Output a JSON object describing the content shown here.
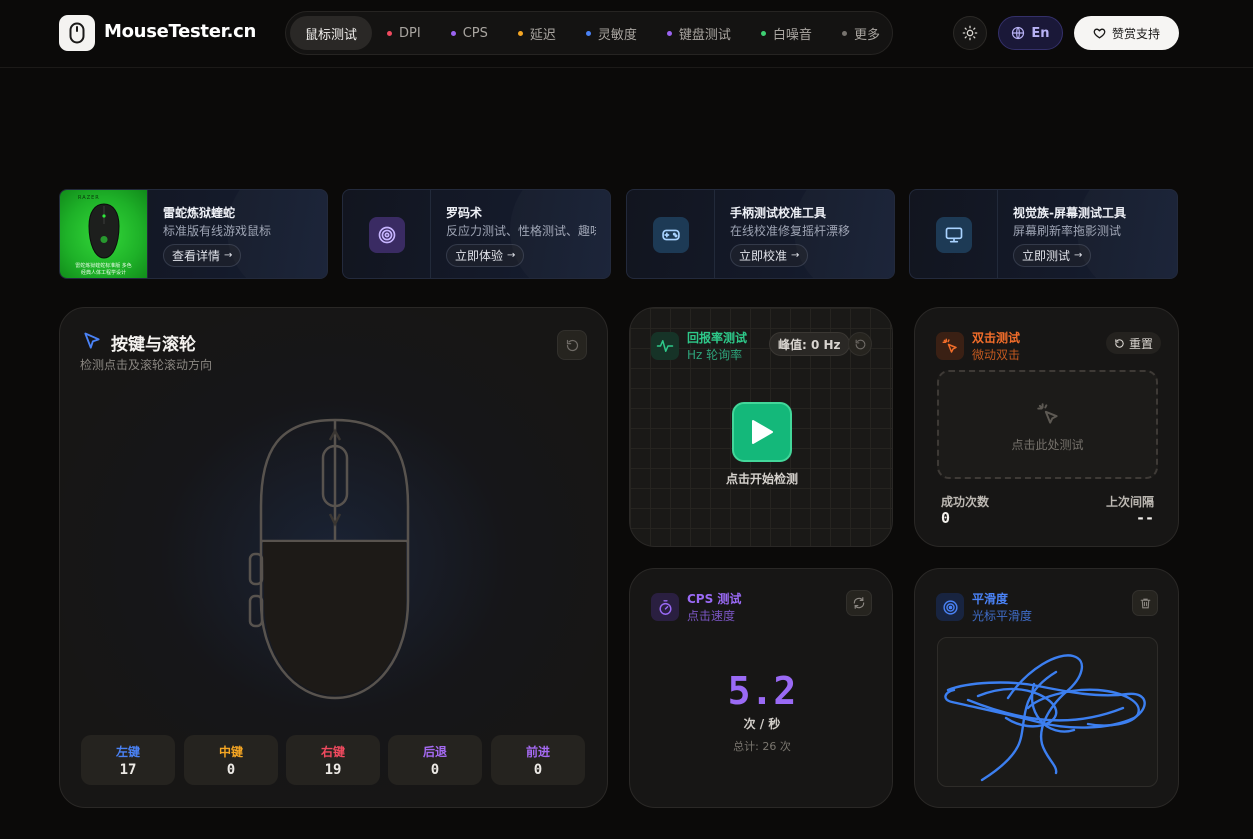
{
  "header": {
    "logo_text": "MouseTester.cn",
    "nav": [
      {
        "label": "鼠标测试",
        "active": true,
        "dot": ""
      },
      {
        "label": "DPI",
        "active": false,
        "dot": "#f04a5f"
      },
      {
        "label": "CPS",
        "active": false,
        "dot": "#9a63f0"
      },
      {
        "label": "延迟",
        "active": false,
        "dot": "#f5a623"
      },
      {
        "label": "灵敏度",
        "active": false,
        "dot": "#4a82f5"
      },
      {
        "label": "键盘测试",
        "active": false,
        "dot": "#9a63f0"
      },
      {
        "label": "白噪音",
        "active": false,
        "dot": "#3ecf72"
      },
      {
        "label": "更多",
        "active": false,
        "dot": "#77736e"
      }
    ],
    "lang_label": "En",
    "donate_label": "赞赏支持"
  },
  "promos": [
    {
      "title": "雷蛇炼狱蝰蛇",
      "desc": "标准版有线游戏鼠标",
      "button": "查看详情",
      "thumb_caption_1": "雷蛇炼狱蝰蛇标准版 多色",
      "thumb_caption_2": "经典人体工程学设计",
      "thumb_brand": "RAZER"
    },
    {
      "title": "罗码术",
      "desc": "反应力测试、性格测试、趣味测试",
      "button": "立即体验"
    },
    {
      "title": "手柄测试校准工具",
      "desc": "在线校准修复摇杆漂移",
      "button": "立即校准"
    },
    {
      "title": "视觉族-屏幕测试工具",
      "desc": "屏幕刷新率拖影测试",
      "button": "立即测试"
    }
  ],
  "buttons_card": {
    "title": "按键与滚轮",
    "subtitle": "检测点击及滚轮滚动方向",
    "stats": [
      {
        "label": "左键",
        "value": "17",
        "color": "#4a82f5"
      },
      {
        "label": "中键",
        "value": "0",
        "color": "#f5a623"
      },
      {
        "label": "右键",
        "value": "19",
        "color": "#f04a5f"
      },
      {
        "label": "后退",
        "value": "0",
        "color": "#a56af2"
      },
      {
        "label": "前进",
        "value": "0",
        "color": "#a56af2"
      }
    ]
  },
  "polling_card": {
    "title": "回报率测试",
    "subtitle": "Hz 轮询率",
    "peak_label": "峰值: 0 Hz",
    "start_label": "点击开始检测",
    "accent": "#2ec98a"
  },
  "double_click_card": {
    "title": "双击测试",
    "subtitle": "微动双击",
    "reset_label": "重置",
    "area_label": "点击此处测试",
    "success_label": "成功次数",
    "success_value": "0",
    "interval_label": "上次间隔",
    "interval_value": "--",
    "accent": "#f26d2a"
  },
  "cps_card": {
    "title": "CPS 测试",
    "subtitle": "点击速度",
    "value": "5.2",
    "unit": "次 / 秒",
    "total": "总计: 26 次",
    "accent": "#9a6af5"
  },
  "smooth_card": {
    "title": "平滑度",
    "subtitle": "光标平滑度",
    "accent": "#4a82f5"
  }
}
